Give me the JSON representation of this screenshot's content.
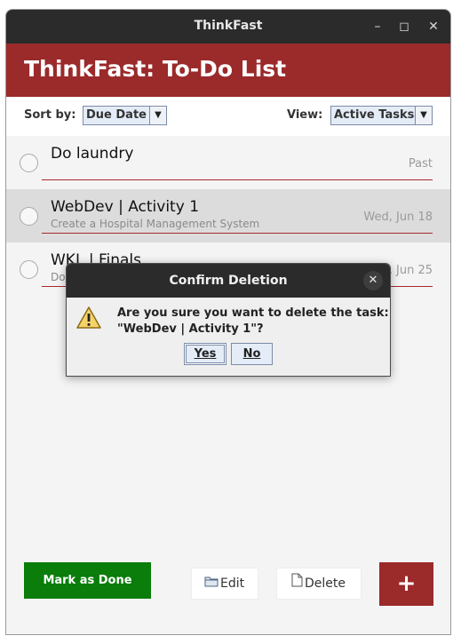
{
  "window": {
    "title": "ThinkFast"
  },
  "header": {
    "title": "ThinkFast: To-Do List"
  },
  "toolbar": {
    "sort_label": "Sort by:",
    "sort_value": "Due Date",
    "view_label": "View:",
    "view_value": "Active Tasks"
  },
  "tasks": [
    {
      "title": "Do laundry",
      "description": "",
      "date": "Past",
      "selected": false
    },
    {
      "title": "WebDev | Activity 1",
      "description": "Create a Hospital Management System",
      "date": "Wed, Jun 18",
      "selected": true
    },
    {
      "title": "WKL | Finals",
      "description": "Do",
      "date": "l, Jun 25",
      "selected": false
    }
  ],
  "actions": {
    "mark_done": "Mark as Done",
    "edit": "Edit",
    "delete": "Delete",
    "add": "+"
  },
  "dialog": {
    "title": "Confirm Deletion",
    "message_line1": "Are you sure you want to delete the task:",
    "message_line2": "\"WebDev | Activity 1\"?",
    "yes": "Yes",
    "no": "No"
  },
  "colors": {
    "brand": "#9b2a2a",
    "done_button": "#0a7d0a",
    "titlebar": "#2b2b2b",
    "selected_row": "#dcdcdc"
  }
}
